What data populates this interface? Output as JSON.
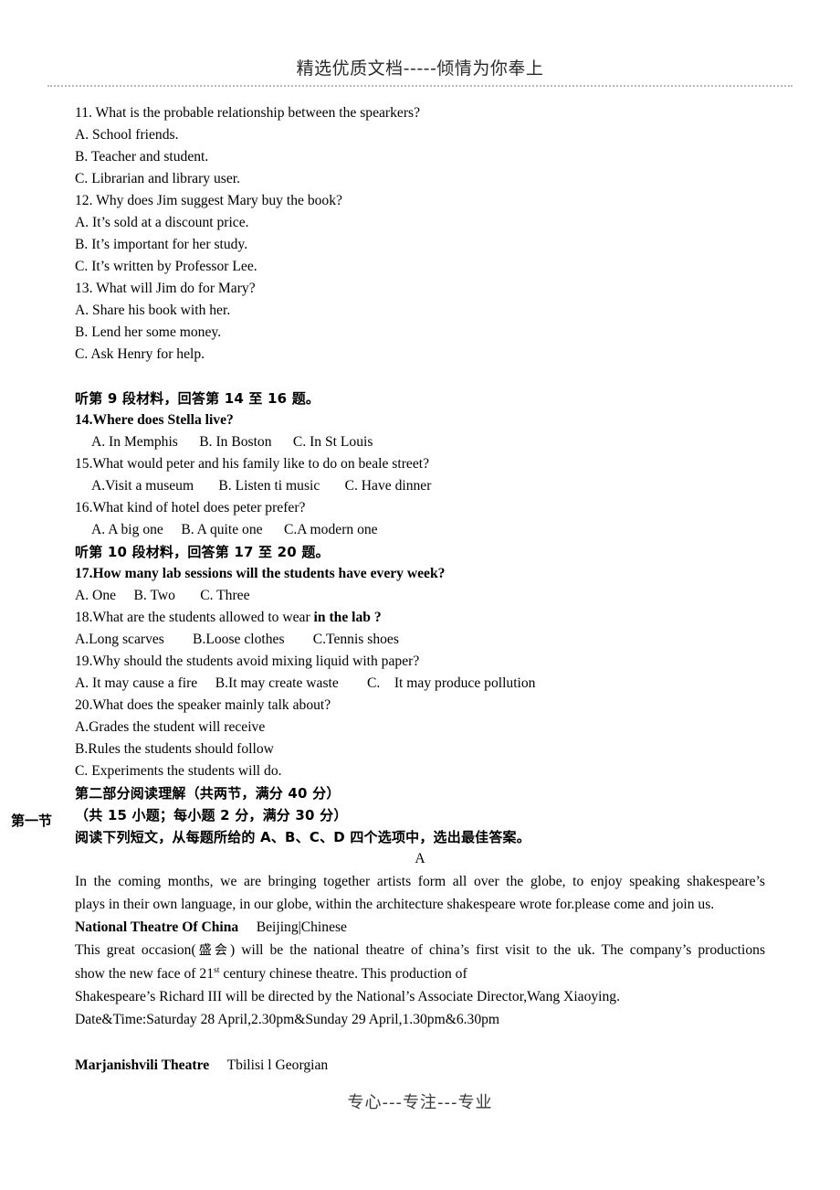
{
  "header": {
    "title": "精选优质文档-----倾情为你奉上"
  },
  "footer": {
    "text": "专心---专注---专业"
  },
  "listening": {
    "q11": {
      "stem": "11. What is the probable relationship between the spearkers?",
      "options": [
        "A. School friends.",
        "B. Teacher and student.",
        "C. Librarian and library user."
      ]
    },
    "q12": {
      "stem": "12. Why does Jim suggest Mary buy the book?",
      "options": [
        "A. It’s sold at a discount price.",
        "B. It’s important for her study.",
        "C. It’s written by Professor Lee."
      ]
    },
    "q13": {
      "stem": "13. What will Jim do for Mary?",
      "options": [
        "A. Share his book with her.",
        "B. Lend her some money.",
        "C. Ask Henry for help."
      ]
    },
    "section9_heading": "听第 9 段材料，回答第 14 至 16 题。",
    "q14": {
      "stem": "14.Where does Stella live?",
      "options_line": "A. In Memphis      B. In Boston      C. In St Louis"
    },
    "q15": {
      "stem": "15.What would peter and his family like to do on beale street?",
      "options_line": "A.Visit a museum       B. Listen ti music       C. Have dinner"
    },
    "q16": {
      "stem": "16.What kind of hotel does peter prefer?",
      "options_line": "A. A big one     B. A quite one      C.A modern one"
    },
    "section10_heading": "听第 10 段材料，回答第 17 至 20 题。",
    "q17": {
      "stem": "17.How many lab sessions will the students have every week?",
      "options_line": "A. One     B. Two       C. Three"
    },
    "q18": {
      "stem_plain": "18.What are the students allowed to wear ",
      "stem_bold": "in the lab ?",
      "options_line": "A.Long scarves        B.Loose clothes        C.Tennis shoes"
    },
    "q19": {
      "stem": "19.Why should the students avoid mixing liquid with paper?",
      "options_line": "A. It may cause a fire     B.It may create waste        C.    It may produce pollution"
    },
    "q20": {
      "stem": "20.What does the speaker mainly talk about?",
      "options": [
        "A.Grades the student will receive",
        "B.Rules the students should follow",
        "C. Experiments the students will do."
      ]
    }
  },
  "reading": {
    "part_heading": "第二部分阅读理解（共两节，满分 40 分）",
    "gutter_label": "第一节",
    "section_heading": "（共 15 小题；每小题 2 分，满分 30 分）",
    "instruction": "阅读下列短文，从每题所给的 A、B、C、D 四个选项中，选出最佳答案。",
    "passage_label": "A",
    "passage_line1": "In the coming months, we are bringing together artists form all over the globe, to enjoy speaking shakespeare’s",
    "passage_line2": "plays in their own language, in our globe, within the architecture shakespeare wrote for.please come and join us.",
    "theatre1": {
      "name": "National Theatre Of China",
      "location": "Beijing|Chinese"
    },
    "desc_line1_a": "This great occasion(",
    "desc_line1_cjk": "盛会",
    "desc_line1_b": ") will be the national theatre of china’s first visit to the uk. The company’s productions",
    "desc_line2_a": "show the new face of 21",
    "desc_line2_sup": "st",
    "desc_line2_b": " century chinese theatre. This production of",
    "desc_line3": "Shakespeare’s Richard III will be directed by the National’s Associate Director,Wang Xiaoying.",
    "desc_line4": "Date&Time:Saturday 28 April,2.30pm&Sunday 29 April,1.30pm&6.30pm",
    "theatre2": {
      "name": "Marjanishvili Theatre",
      "location": "Tbilisi l Georgian"
    }
  }
}
